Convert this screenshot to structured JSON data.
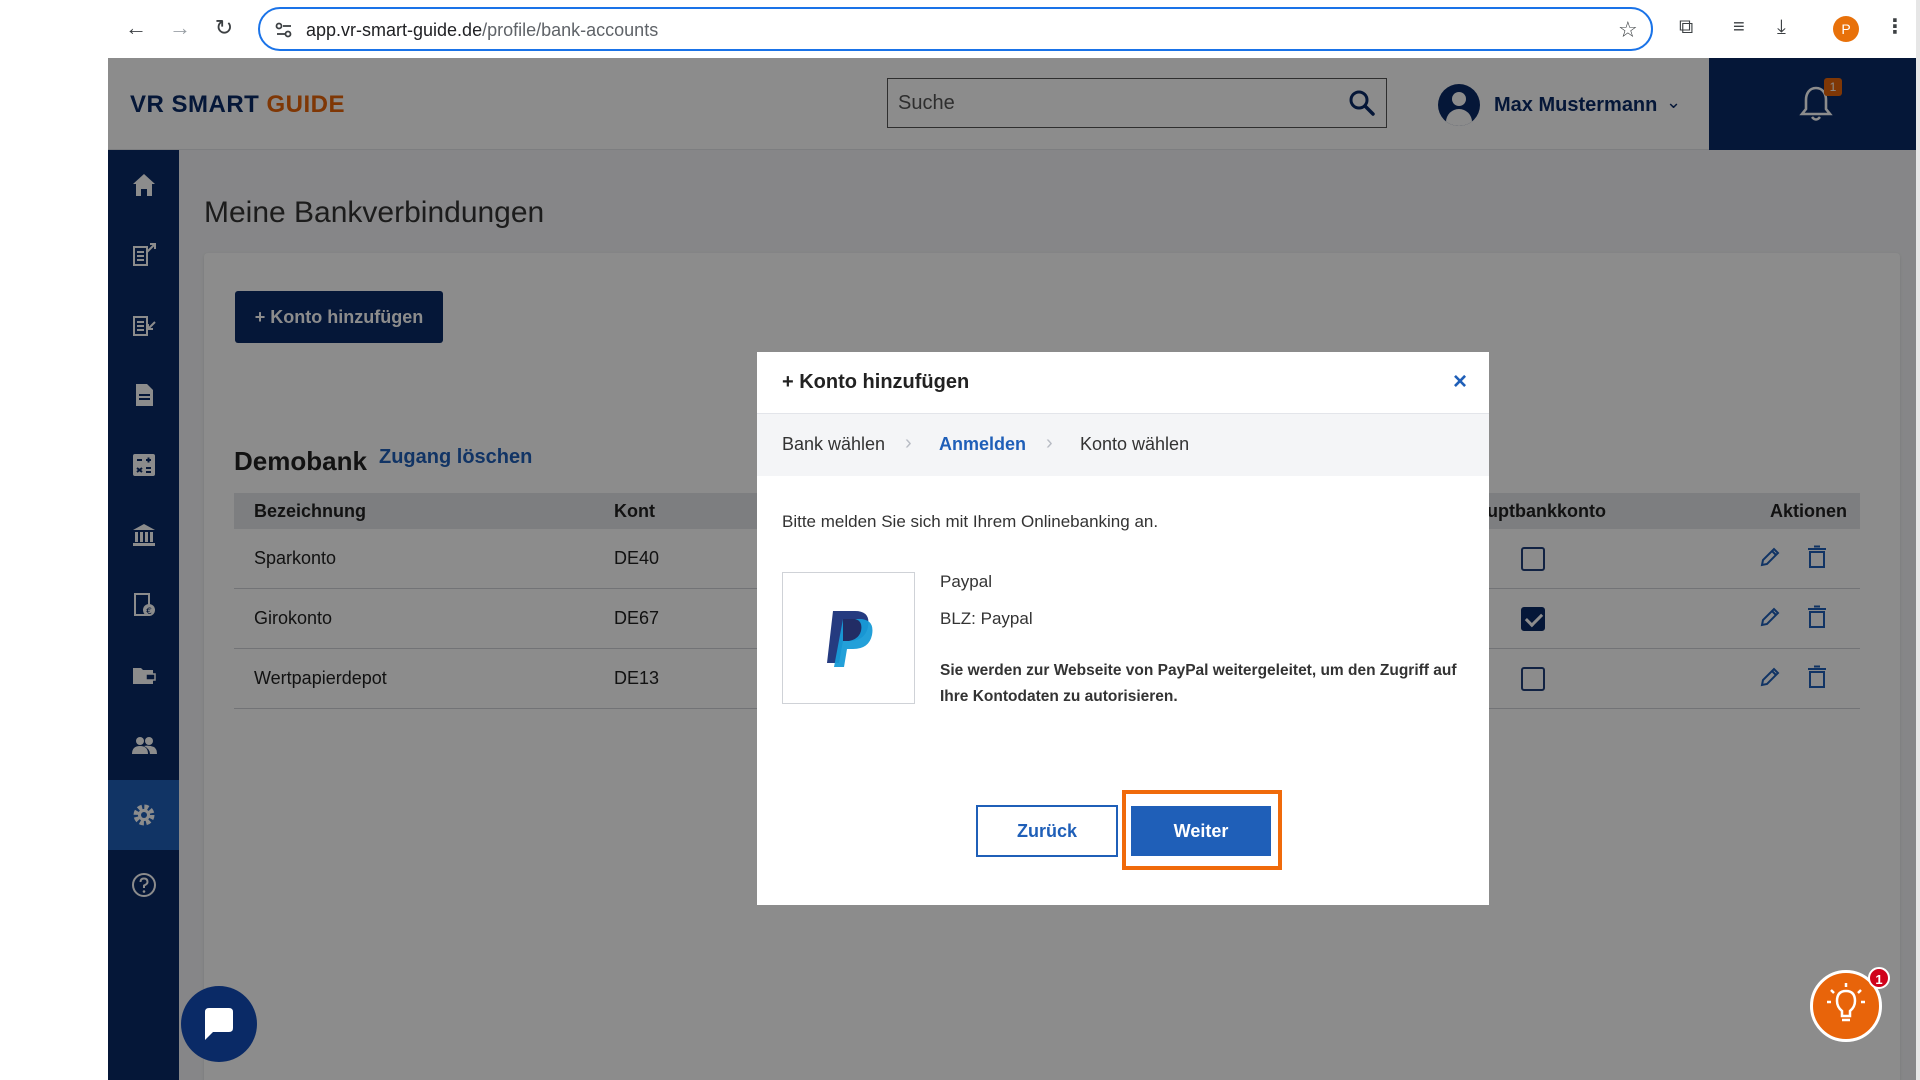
{
  "browser": {
    "url_host": "app.vr-smart-guide.de",
    "url_path": "/profile/bank-accounts",
    "profile_initial": "P"
  },
  "header": {
    "logo_part1": "VR SMART",
    "logo_part2": "GUIDE",
    "search_placeholder": "Suche",
    "user_name": "Max Mustermann",
    "notification_count": "1"
  },
  "sidebar": {
    "items": [
      "home-icon",
      "export-icon",
      "import-icon",
      "document-icon",
      "calculator-icon",
      "bank-icon",
      "contract-icon",
      "folder-icon",
      "people-icon",
      "settings-icon",
      "help-icon"
    ],
    "active_index": 9
  },
  "page": {
    "title": "Meine Bankverbindungen",
    "add_button": "+ Konto hinzufügen",
    "bank_name": "Demobank",
    "delete_access": "Zugang löschen",
    "columns": [
      "Bezeichnung",
      "Kont",
      "Hauptbankkonto",
      "Aktionen"
    ],
    "rows": [
      {
        "name": "Sparkonto",
        "iban": "DE40",
        "main": false
      },
      {
        "name": "Girokonto",
        "iban": "DE67",
        "main": true
      },
      {
        "name": "Wertpapierdepot",
        "iban": "DE13",
        "main": false
      }
    ]
  },
  "modal": {
    "title": "+ Konto hinzufügen",
    "close": "×",
    "steps": [
      "Bank wählen",
      "Anmelden",
      "Konto wählen"
    ],
    "active_step": 1,
    "intro": "Bitte melden Sie sich mit Ihrem Onlinebanking an.",
    "bank_title": "Paypal",
    "bank_blz": "BLZ: Paypal",
    "note": "Sie werden zur Webseite von PayPal weitergeleitet, um den Zugriff auf Ihre Kontodaten zu autorisieren.",
    "back_button": "Zurück",
    "next_button": "Weiter"
  },
  "tip_badge": "1",
  "colors": {
    "brand_navy": "#0a2a66",
    "brand_orange": "#e8640a",
    "accent_blue": "#1f5fb8",
    "highlight": "#f06a0a"
  }
}
